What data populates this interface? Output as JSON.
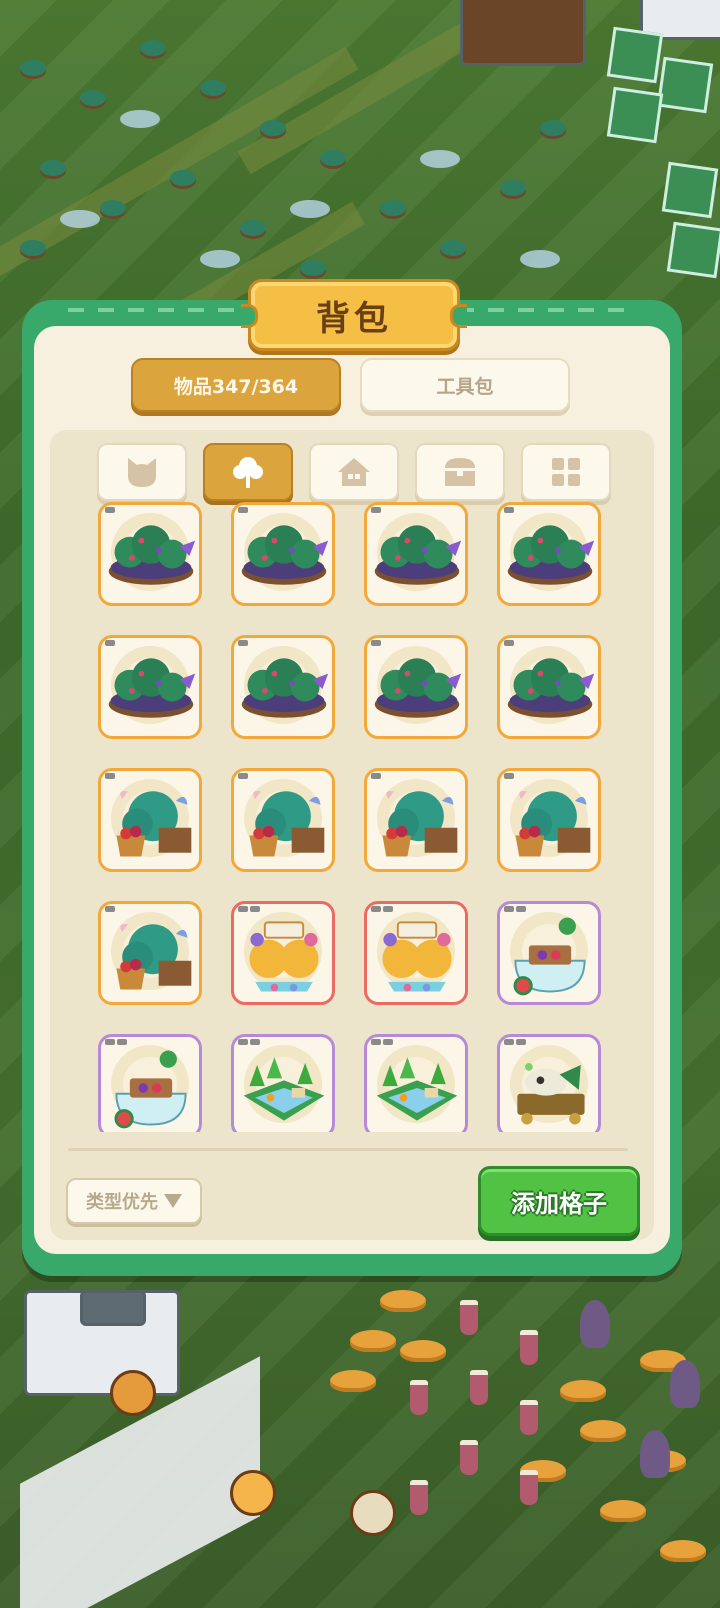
{
  "panel": {
    "title": "背包",
    "tabs": [
      {
        "label": "物品347/364",
        "active": true
      },
      {
        "label": "工具包",
        "active": false
      }
    ],
    "categories": [
      {
        "icon": "cat-face-icon",
        "active": false
      },
      {
        "icon": "tree-icon",
        "active": true
      },
      {
        "icon": "house-icon",
        "active": false
      },
      {
        "icon": "treasure-chest-icon",
        "active": false
      },
      {
        "icon": "grid-icon",
        "active": false
      }
    ],
    "items": [
      {
        "kind": "bush-purple",
        "rarity": "orange"
      },
      {
        "kind": "bush-purple",
        "rarity": "orange"
      },
      {
        "kind": "bush-purple",
        "rarity": "orange"
      },
      {
        "kind": "bush-purple",
        "rarity": "orange"
      },
      {
        "kind": "bush-purple",
        "rarity": "orange"
      },
      {
        "kind": "bush-purple",
        "rarity": "orange"
      },
      {
        "kind": "bush-purple",
        "rarity": "orange"
      },
      {
        "kind": "bush-purple",
        "rarity": "orange"
      },
      {
        "kind": "bush-fruit-basket",
        "rarity": "orange"
      },
      {
        "kind": "bush-fruit-basket",
        "rarity": "orange"
      },
      {
        "kind": "bush-fruit-basket",
        "rarity": "orange"
      },
      {
        "kind": "bush-fruit-basket",
        "rarity": "orange"
      },
      {
        "kind": "bush-fruit-basket",
        "rarity": "orange"
      },
      {
        "kind": "cake-tree-stall",
        "rarity": "red"
      },
      {
        "kind": "cake-tree-stall",
        "rarity": "red"
      },
      {
        "kind": "fruit-bathtub",
        "rarity": "purple"
      },
      {
        "kind": "fruit-bathtub",
        "rarity": "purple"
      },
      {
        "kind": "forest-stream",
        "rarity": "purple"
      },
      {
        "kind": "forest-stream",
        "rarity": "purple"
      },
      {
        "kind": "dino-skull-cart",
        "rarity": "purple"
      }
    ],
    "sort_label": "类型优先",
    "add_label": "添加格子"
  },
  "colors": {
    "panel_green": "#39a86b",
    "tab_gold": "#dba43c",
    "rarity_orange": "#f0a93a",
    "rarity_red": "#ea6a64",
    "rarity_purple": "#b78ad8",
    "add_green": "#52c244"
  }
}
